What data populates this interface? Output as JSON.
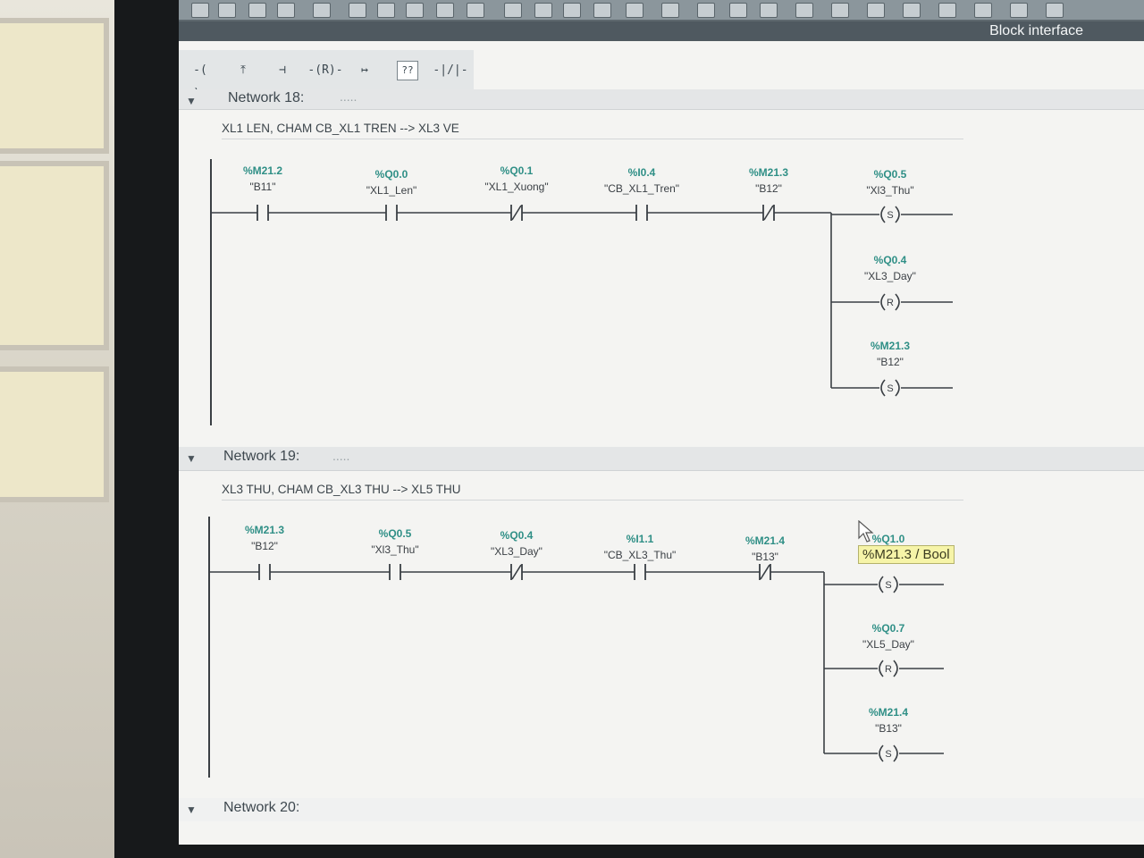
{
  "window": {
    "title_right": "Block interface"
  },
  "ladder_toolbar": {
    "buttons": [
      {
        "label": "-( )-",
        "icon": "coil-icon"
      },
      {
        "label": "⤒",
        "icon": "open-branch-icon"
      },
      {
        "label": "⊣",
        "icon": "close-branch-icon"
      },
      {
        "label": "-(R)-",
        "icon": "reset-coil-icon"
      },
      {
        "label": "↦",
        "icon": "jump-icon"
      },
      {
        "label": "??",
        "icon": "empty-box-icon"
      },
      {
        "label": "-|/|-",
        "icon": "nc-contact-icon"
      }
    ]
  },
  "networks": [
    {
      "label": "Network 18:",
      "dots": ".....",
      "comment": "XL1 LEN, CHAM CB_XL1 TREN  --> XL3 VE",
      "contacts": [
        {
          "address": "%M21.2",
          "symbol": "\"B11\"",
          "type": "NO"
        },
        {
          "address": "%Q0.0",
          "symbol": "\"XL1_Len\"",
          "type": "NO"
        },
        {
          "address": "%Q0.1",
          "symbol": "\"XL1_Xuong\"",
          "type": "NC"
        },
        {
          "address": "%I0.4",
          "symbol": "\"CB_XL1_Tren\"",
          "type": "NO"
        },
        {
          "address": "%M21.3",
          "symbol": "\"B12\"",
          "type": "NC"
        }
      ],
      "coils": [
        {
          "address": "%Q0.5",
          "symbol": "\"Xl3_Thu\"",
          "type": "S"
        },
        {
          "address": "%Q0.4",
          "symbol": "\"XL3_Day\"",
          "type": "R"
        },
        {
          "address": "%M21.3",
          "symbol": "\"B12\"",
          "type": "S"
        }
      ]
    },
    {
      "label": "Network 19:",
      "dots": ".....",
      "comment": "XL3 THU, CHAM CB_XL3 THU  --> XL5 THU",
      "contacts": [
        {
          "address": "%M21.3",
          "symbol": "\"B12\"",
          "type": "NO"
        },
        {
          "address": "%Q0.5",
          "symbol": "\"Xl3_Thu\"",
          "type": "NO"
        },
        {
          "address": "%Q0.4",
          "symbol": "\"XL3_Day\"",
          "type": "NC"
        },
        {
          "address": "%I1.1",
          "symbol": "\"CB_XL3_Thu\"",
          "type": "NO"
        },
        {
          "address": "%M21.4",
          "symbol": "\"B13\"",
          "type": "NC"
        }
      ],
      "coils": [
        {
          "address": "%Q1.0",
          "symbol": "",
          "type": "S"
        },
        {
          "address": "%Q0.7",
          "symbol": "\"XL5_Day\"",
          "type": "R"
        },
        {
          "address": "%M21.4",
          "symbol": "\"B13\"",
          "type": "S"
        }
      ],
      "tooltip": "%M21.3 / Bool"
    },
    {
      "label": "Network 20:",
      "dots": ""
    }
  ],
  "colors": {
    "operand": "#2f8f86",
    "wire": "#3a3f44",
    "tooltip_bg": "#f6f4a8"
  }
}
